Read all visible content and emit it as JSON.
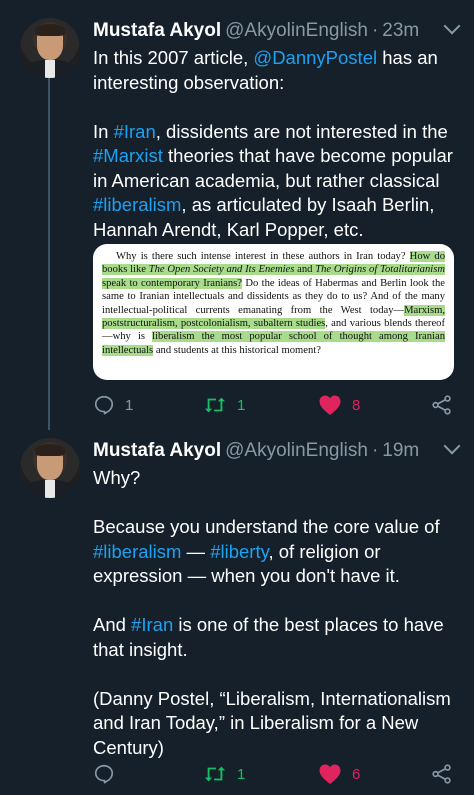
{
  "tweets": [
    {
      "name": "Mustafa Akyol",
      "handle": "@AkyolinEnglish",
      "separator": "·",
      "time": "23m",
      "p1": [
        {
          "t": "In this 2007 article, ",
          "link": false
        },
        {
          "t": "@DannyPostel",
          "link": true
        },
        {
          "t": " has an interesting observation:",
          "link": false
        }
      ],
      "p2": [
        {
          "t": "In ",
          "link": false
        },
        {
          "t": "#Iran",
          "link": true
        },
        {
          "t": ", dissidents are not interested in the ",
          "link": false
        },
        {
          "t": "#Marxist",
          "link": true
        },
        {
          "t": " theories that have become popular in American academia, but rather classical ",
          "link": false
        },
        {
          "t": "#liberalism",
          "link": true
        },
        {
          "t": ", as articulated by Isaah Berlin, Hannah Arendt, Karl Popper, etc.",
          "link": false
        }
      ],
      "quote_segments": [
        {
          "t": "Why is there such intense interest in these authors in Iran today? ",
          "hl": false,
          "i": false
        },
        {
          "t": "How do books like ",
          "hl": true,
          "i": false
        },
        {
          "t": "The Open Society and Its Enemies",
          "hl": true,
          "i": true
        },
        {
          "t": " and ",
          "hl": true,
          "i": false
        },
        {
          "t": "The Origins of Totalitarianism",
          "hl": true,
          "i": true
        },
        {
          "t": " speak to contemporary Iranians?",
          "hl": true,
          "i": false
        },
        {
          "t": " Do the ideas of Habermas and Berlin look the same to Iranian intellectuals and dissidents as they do to us? And of the many intellectual-political currents emanating from the West today—",
          "hl": false,
          "i": false
        },
        {
          "t": "Marxism, poststructuralism, postcolonialism, subaltern studies",
          "hl": true,
          "i": false
        },
        {
          "t": ", and various blends thereof—why is ",
          "hl": false,
          "i": false
        },
        {
          "t": "liberalism the most popular school of thought among Iranian intellectuals",
          "hl": true,
          "i": false
        },
        {
          "t": " and students at this historical moment?",
          "hl": false,
          "i": false
        }
      ],
      "replies": "1",
      "retweets": "1",
      "likes": "8"
    },
    {
      "name": "Mustafa Akyol",
      "handle": "@AkyolinEnglish",
      "separator": "·",
      "time": "19m",
      "p1": [
        {
          "t": "Why?",
          "link": false
        }
      ],
      "p2": [
        {
          "t": "Because you understand the core value of ",
          "link": false
        },
        {
          "t": "#liberalism",
          "link": true
        },
        {
          "t": " — ",
          "link": false
        },
        {
          "t": "#liberty",
          "link": true
        },
        {
          "t": ", of religion or expression — when you don't have it.",
          "link": false
        }
      ],
      "p3": [
        {
          "t": "And ",
          "link": false
        },
        {
          "t": "#Iran",
          "link": true
        },
        {
          "t": " is one of the best places to have that insight.",
          "link": false
        }
      ],
      "p4": [
        {
          "t": "(Danny Postel, “Liberalism, Internationalism and Iran Today,” in Liberalism for a New Century)",
          "link": false
        }
      ],
      "replies": "",
      "retweets": "1",
      "likes": "6"
    }
  ],
  "icons": [
    "reply-icon",
    "retweet-icon",
    "like-icon",
    "share-icon",
    "caret-down-icon"
  ],
  "colors": {
    "background": "#15202b",
    "link": "#1da1f2",
    "muted": "#8899a6",
    "retweet": "#17bf63",
    "like": "#e0245e",
    "highlight": "#a8dc8c"
  }
}
